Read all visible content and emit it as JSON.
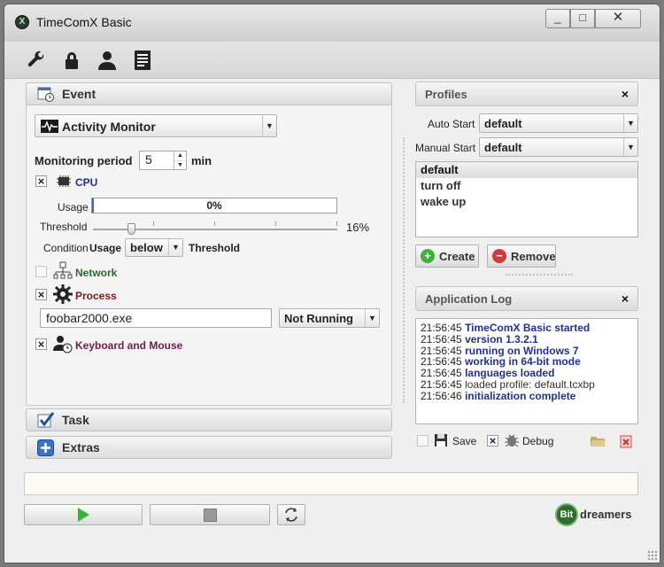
{
  "window": {
    "title": "TimeComX Basic",
    "minimize": "_",
    "maximize": "□",
    "close": "✕"
  },
  "toolbar": {
    "items": [
      {
        "name": "settings",
        "icon": "wrench-icon"
      },
      {
        "name": "lock",
        "icon": "lock-icon"
      },
      {
        "name": "user",
        "icon": "user-icon"
      },
      {
        "name": "document",
        "icon": "document-icon"
      }
    ]
  },
  "event": {
    "header": "Event",
    "monitor_type": "Activity Monitor",
    "monitoring_period_label": "Monitoring period",
    "monitoring_period_value": "5",
    "monitoring_period_unit": "min",
    "cpu": {
      "label": "CPU",
      "checked": true,
      "usage_label": "Usage",
      "usage_percent_text": "0%",
      "usage_fraction": 0.0,
      "threshold_label": "Threshold",
      "threshold_value_text": "16%",
      "threshold_fraction": 0.16,
      "condition_label": "Condition",
      "condition_usage": "Usage",
      "condition_op": "below",
      "condition_threshold": "Threshold"
    },
    "network": {
      "label": "Network",
      "checked": false
    },
    "process": {
      "label": "Process",
      "checked": true,
      "name_value": "foobar2000.exe",
      "state": "Not Running"
    },
    "keyboard_mouse": {
      "label": "Keyboard and Mouse",
      "checked": true
    }
  },
  "task": {
    "header": "Task"
  },
  "extras": {
    "header": "Extras"
  },
  "profiles": {
    "header": "Profiles",
    "close": "×",
    "auto_start_label": "Auto Start",
    "auto_start_value": "default",
    "manual_start_label": "Manual Start",
    "manual_start_value": "default",
    "items": [
      "default",
      "turn off",
      "wake up"
    ],
    "selected_index": 0,
    "create_label": "Create",
    "remove_label": "Remove"
  },
  "app_log": {
    "header": "Application Log",
    "close": "×",
    "entries": [
      {
        "time": "21:56:45",
        "msg": "TimeComX Basic started",
        "highlight": true
      },
      {
        "time": "21:56:45",
        "msg": "version 1.3.2.1",
        "highlight": true
      },
      {
        "time": "21:56:45",
        "msg": "running on Windows 7",
        "highlight": true
      },
      {
        "time": "21:56:45",
        "msg": "working in 64-bit mode",
        "highlight": true
      },
      {
        "time": "21:56:45",
        "msg": "languages loaded",
        "highlight": true
      },
      {
        "time": "21:56:45",
        "msg": "loaded profile: default.tcxbp",
        "highlight": false
      },
      {
        "time": "21:56:46",
        "msg": "initialization complete",
        "highlight": true
      }
    ],
    "save_label": "Save",
    "save_checked": false,
    "debug_label": "Debug",
    "debug_checked": true
  },
  "status_text": "",
  "brand": {
    "badge": "Bit",
    "name": "dreamers"
  },
  "colors": {
    "accent_green": "#3bb33b",
    "link_blue": "#1f2fa0",
    "network_green": "#2e6a2e",
    "process_red": "#7a1a1a",
    "keyboard_purple": "#6a1f4a"
  }
}
